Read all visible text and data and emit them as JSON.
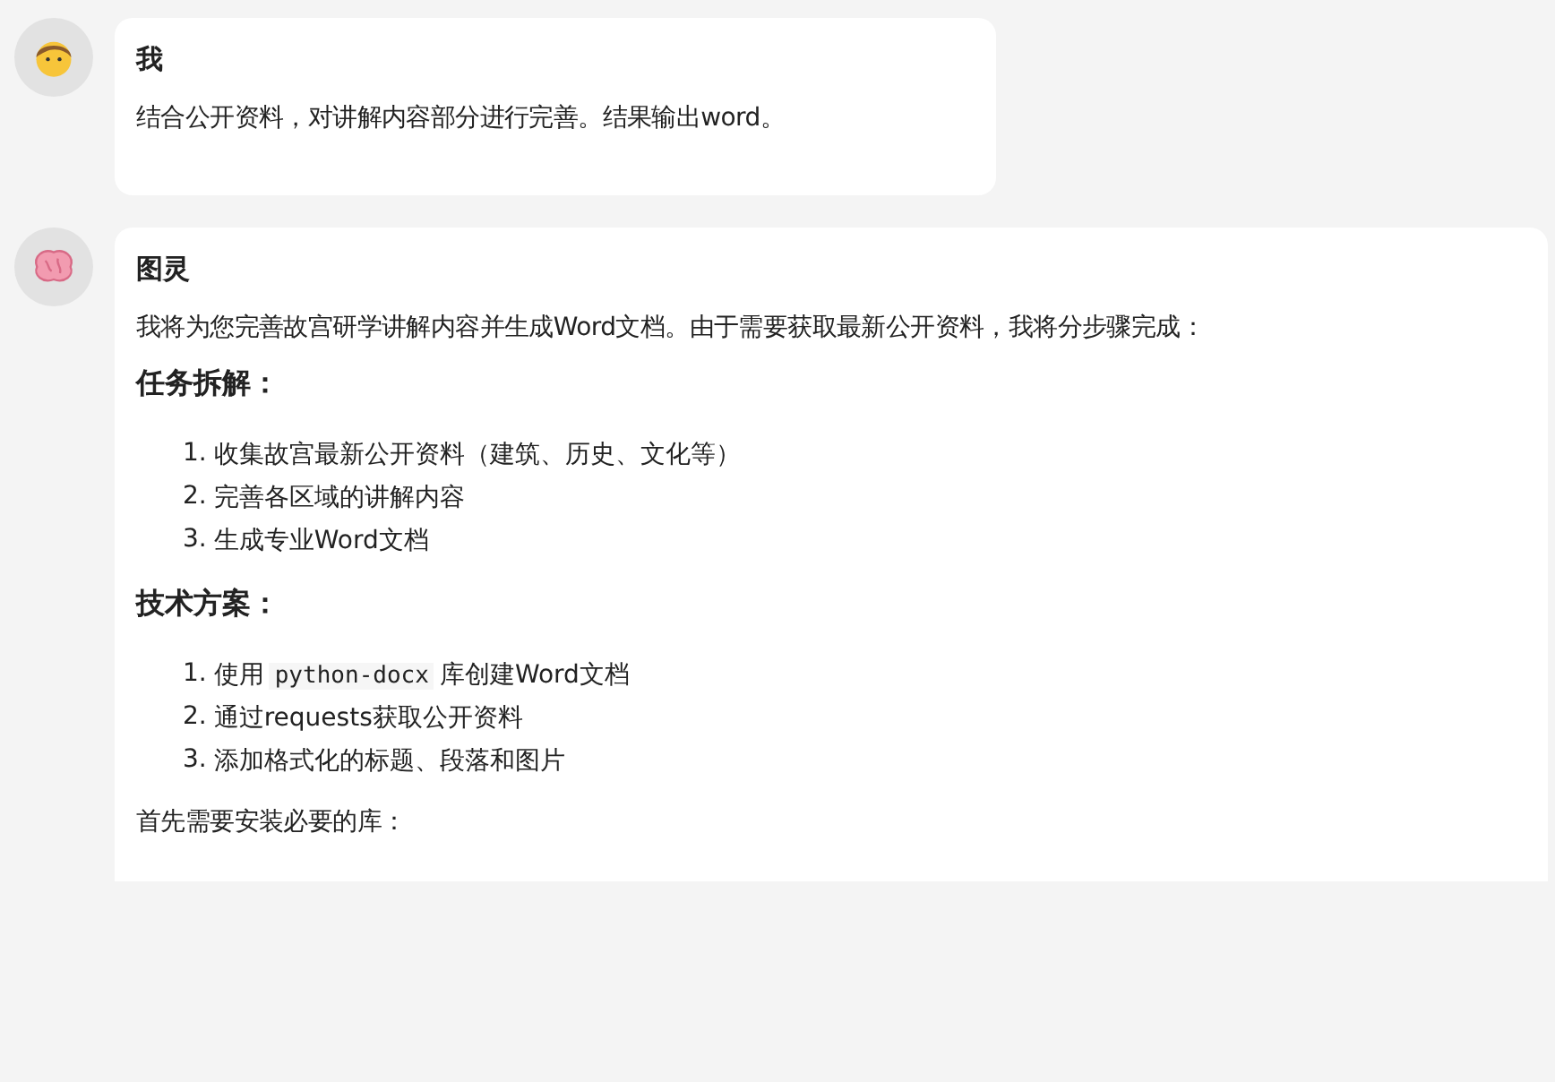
{
  "messages": [
    {
      "kind": "user",
      "sender": "我",
      "blocks": [
        {
          "kind": "paragraph",
          "text": "结合公开资料，对讲解内容部分进行完善。结果输出word。"
        }
      ]
    },
    {
      "kind": "assistant",
      "sender": "图灵",
      "blocks": [
        {
          "kind": "paragraph",
          "text": "我将为您完善故宫研学讲解内容并生成Word文档。由于需要获取最新公开资料，我将分步骤完成："
        },
        {
          "kind": "heading",
          "text": "任务拆解："
        },
        {
          "kind": "list",
          "items": [
            {
              "number": "1.",
              "parts": [
                {
                  "kind": "text",
                  "text": "收集故宫最新公开资料（建筑、历史、文化等）"
                }
              ]
            },
            {
              "number": "2.",
              "parts": [
                {
                  "kind": "text",
                  "text": "完善各区域的讲解内容"
                }
              ]
            },
            {
              "number": "3.",
              "parts": [
                {
                  "kind": "text",
                  "text": "生成专业Word文档"
                }
              ]
            }
          ]
        },
        {
          "kind": "heading",
          "text": "技术方案："
        },
        {
          "kind": "list",
          "items": [
            {
              "number": "1.",
              "parts": [
                {
                  "kind": "text",
                  "text": "使用"
                },
                {
                  "kind": "code",
                  "text": "python-docx"
                },
                {
                  "kind": "text",
                  "text": "库创建Word文档"
                }
              ]
            },
            {
              "number": "2.",
              "parts": [
                {
                  "kind": "text",
                  "text": "通过requests获取公开资料"
                }
              ]
            },
            {
              "number": "3.",
              "parts": [
                {
                  "kind": "text",
                  "text": "添加格式化的标题、段落和图片"
                }
              ]
            }
          ]
        },
        {
          "kind": "paragraph",
          "text": "首先需要安装必要的库："
        }
      ]
    }
  ]
}
